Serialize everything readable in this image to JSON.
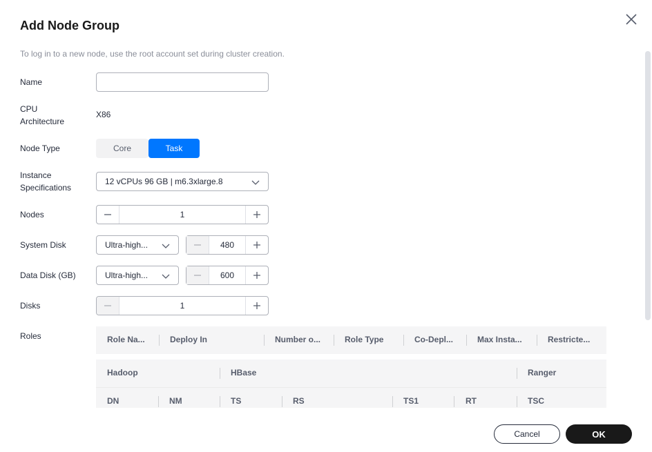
{
  "dialog": {
    "title": "Add Node Group",
    "hint": "To log in to a new node, use the root account set during cluster creation."
  },
  "form": {
    "name": {
      "label": "Name",
      "value": "",
      "placeholder": ""
    },
    "cpu_arch": {
      "label_line1": "CPU",
      "label_line2": "Architecture",
      "value": "X86"
    },
    "node_type": {
      "label": "Node Type",
      "options": [
        "Core",
        "Task"
      ],
      "selected": "Task"
    },
    "instance_spec": {
      "label_line1": "Instance",
      "label_line2": "Specifications",
      "value": "12 vCPUs 96 GB | m6.3xlarge.8"
    },
    "nodes": {
      "label": "Nodes",
      "value": "1"
    },
    "system_disk": {
      "label": "System Disk",
      "type": "Ultra-high...",
      "size": "480"
    },
    "data_disk": {
      "label": "Data Disk (GB)",
      "type": "Ultra-high...",
      "size": "600"
    },
    "disks": {
      "label": "Disks",
      "value": "1"
    },
    "roles": {
      "label": "Roles"
    }
  },
  "roles_table": {
    "headers": [
      "Role Na...",
      "Deploy In",
      "Number o...",
      "Role Type",
      "Co-Depl...",
      "Max Insta...",
      "Restricte..."
    ],
    "groups": [
      "Hadoop",
      "HBase",
      "Ranger"
    ],
    "subheaders": [
      "DN",
      "NM",
      "TS",
      "RS",
      "TS1",
      "RT",
      "TSC"
    ]
  },
  "footer": {
    "cancel": "Cancel",
    "ok": "OK"
  },
  "colors": {
    "accent": "#0077ff",
    "primary_button": "#191919"
  },
  "icons": {
    "close": "close-icon",
    "chevron": "chevron-down-icon",
    "minus": "minus-icon",
    "plus": "plus-icon"
  }
}
